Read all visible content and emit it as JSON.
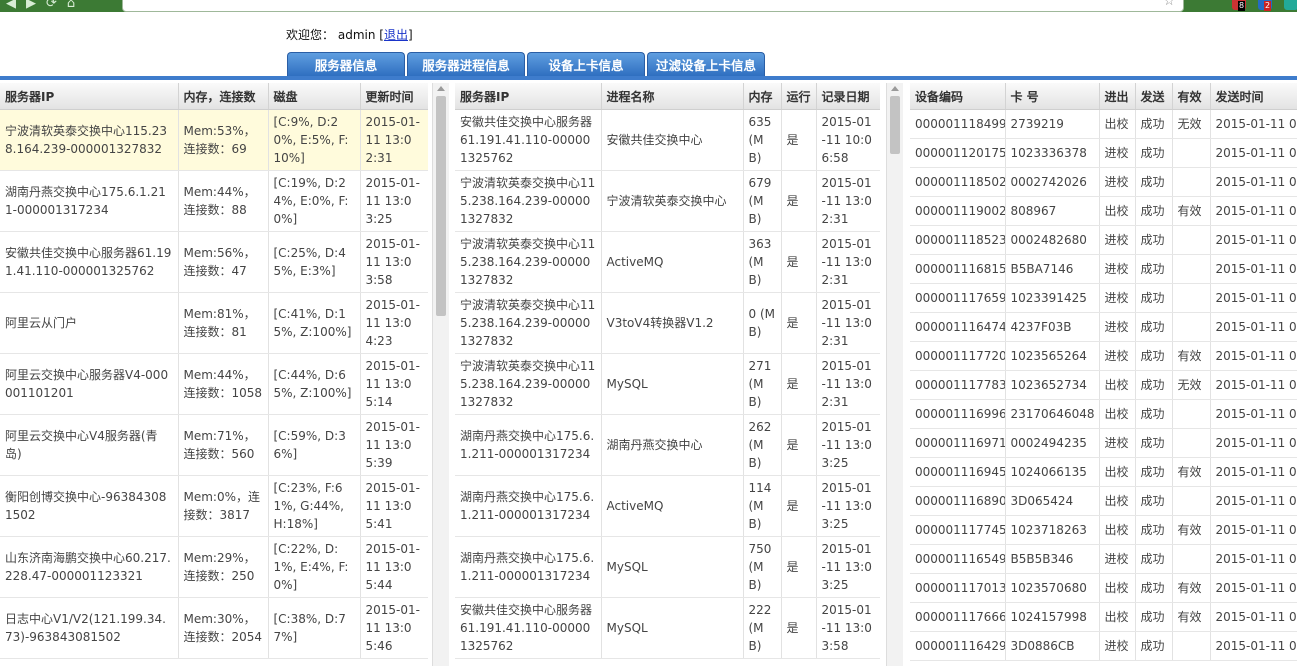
{
  "welcome": {
    "prefix": "欢迎您：",
    "user": "admin",
    "bracket_open": "[",
    "logout": "退出",
    "bracket_close": "]"
  },
  "tabs": [
    "服务器信息",
    "服务器进程信息",
    "设备上卡信息",
    "过滤设备上卡信息"
  ],
  "server_table": {
    "headers": [
      "服务器IP",
      "内存，连接数",
      "磁盘",
      "更新时间"
    ],
    "rows": [
      [
        "宁波清软英泰交换中心115.238.164.239-000001327832",
        "Mem:53%，连接数：69",
        "[C:9%, D:20%, E:5%, F:10%]",
        "2015-01-11 13:02:31"
      ],
      [
        "湖南丹燕交换中心175.6.1.211-000001317234",
        "Mem:44%，连接数：88",
        "[C:19%, D:24%, E:0%, F:0%]",
        "2015-01-11 13:03:25"
      ],
      [
        "安徽共佳交换中心服务器61.191.41.110-000001325762",
        "Mem:56%，连接数：47",
        "[C:25%, D:45%, E:3%]",
        "2015-01-11 13:03:58"
      ],
      [
        "阿里云从门户",
        "Mem:81%，连接数：81",
        "[C:41%, D:15%, Z:100%]",
        "2015-01-11 13:04:23"
      ],
      [
        "阿里云交换中心服务器V4-000001101201",
        "Mem:44%，连接数：1058",
        "[C:44%, D:65%, Z:100%]",
        "2015-01-11 13:05:14"
      ],
      [
        "阿里云交换中心V4服务器(青岛)",
        "Mem:71%，连接数：560",
        "[C:59%, D:36%]",
        "2015-01-11 13:05:39"
      ],
      [
        "衡阳创博交换中心-963843081502",
        "Mem:0%，连接数：3817",
        "[C:23%, F:61%, G:44%, H:18%]",
        "2015-01-11 13:05:41"
      ],
      [
        "山东济南海鹏交换中心60.217.228.47-000001123321",
        "Mem:29%，连接数：250",
        "[C:22%, D:1%, E:4%, F:0%]",
        "2015-01-11 13:05:44"
      ],
      [
        "日志中心V1/V2(121.199.34.73)-963843081502",
        "Mem:30%，连接数：2054",
        "[C:38%, D:77%]",
        "2015-01-11 13:05:46"
      ]
    ]
  },
  "process_table": {
    "headers": [
      "服务器IP",
      "进程名称",
      "内存",
      "运行",
      "记录日期"
    ],
    "rows": [
      [
        "安徽共佳交换中心服务器61.191.41.110-000001325762",
        "安徽共佳交换中心",
        "635 (MB)",
        "是",
        "2015-01-11 10:06:58"
      ],
      [
        "宁波清软英泰交换中心115.238.164.239-000001327832",
        "宁波清软英泰交换中心",
        "679 (MB)",
        "是",
        "2015-01-11 13:02:31"
      ],
      [
        "宁波清软英泰交换中心115.238.164.239-000001327832",
        "ActiveMQ",
        "363 (MB)",
        "是",
        "2015-01-11 13:02:31"
      ],
      [
        "宁波清软英泰交换中心115.238.164.239-000001327832",
        "V3toV4转换器V1.2",
        "0 (MB)",
        "是",
        "2015-01-11 13:02:31"
      ],
      [
        "宁波清软英泰交换中心115.238.164.239-000001327832",
        "MySQL",
        "271 (MB)",
        "是",
        "2015-01-11 13:02:31"
      ],
      [
        "湖南丹燕交换中心175.6.1.211-000001317234",
        "湖南丹燕交换中心",
        "262 (MB)",
        "是",
        "2015-01-11 13:03:25"
      ],
      [
        "湖南丹燕交换中心175.6.1.211-000001317234",
        "ActiveMQ",
        "114 (MB)",
        "是",
        "2015-01-11 13:03:25"
      ],
      [
        "湖南丹燕交换中心175.6.1.211-000001317234",
        "MySQL",
        "750 (MB)",
        "是",
        "2015-01-11 13:03:25"
      ],
      [
        "安徽共佳交换中心服务器61.191.41.110-000001325762",
        "MySQL",
        "222 (MB)",
        "是",
        "2015-01-11 13:03:58"
      ]
    ]
  },
  "device_table": {
    "headers": [
      "设备编码",
      "卡 号",
      "进出",
      "发送",
      "有效",
      "发送时间"
    ],
    "rows": [
      [
        "000001118499",
        "2739219",
        "出校",
        "成功",
        "无效",
        "2015-01-11 05:4"
      ],
      [
        "000001120175",
        "1023336378",
        "进校",
        "成功",
        "",
        "2015-01-11 05:5"
      ],
      [
        "000001118502",
        "0002742026",
        "进校",
        "成功",
        "",
        "2015-01-11 06:4"
      ],
      [
        "000001119002",
        "808967",
        "出校",
        "成功",
        "有效",
        "2015-01-11 07:0"
      ],
      [
        "000001118523",
        "0002482680",
        "进校",
        "成功",
        "",
        "2015-01-11 07:0"
      ],
      [
        "000001116815",
        "B5BA7146",
        "进校",
        "成功",
        "",
        "2015-01-11 07:2"
      ],
      [
        "000001117659",
        "1023391425",
        "进校",
        "成功",
        "",
        "2015-01-11 07:3"
      ],
      [
        "000001116474",
        "4237F03B",
        "进校",
        "成功",
        "",
        "2015-01-11 07:4"
      ],
      [
        "000001117720",
        "1023565264",
        "进校",
        "成功",
        "有效",
        "2015-01-11 07:4"
      ],
      [
        "000001117783",
        "1023652734",
        "出校",
        "成功",
        "无效",
        "2015-01-11 07:4"
      ],
      [
        "000001116996",
        "23170646048",
        "出校",
        "成功",
        "",
        "2015-01-11 08:0"
      ],
      [
        "000001116971",
        "0002494235",
        "进校",
        "成功",
        "",
        "2015-01-11 08:2"
      ],
      [
        "000001116945",
        "1024066135",
        "出校",
        "成功",
        "有效",
        "2015-01-11 08:2"
      ],
      [
        "000001116890",
        "3D065424",
        "出校",
        "成功",
        "",
        "2015-01-11 08:3"
      ],
      [
        "000001117745",
        "1023718263",
        "出校",
        "成功",
        "有效",
        "2015-01-11 08:3"
      ],
      [
        "000001116549",
        "B5B5B346",
        "进校",
        "成功",
        "",
        "2015-01-11 08:3"
      ],
      [
        "000001117013",
        "1023570680",
        "出校",
        "成功",
        "有效",
        "2015-01-11 08:3"
      ],
      [
        "000001117666",
        "1024157998",
        "出校",
        "成功",
        "有效",
        "2015-01-11 08:4"
      ],
      [
        "000001116429",
        "3D0886CB",
        "进校",
        "成功",
        "",
        "2015-01-11 08:4"
      ]
    ]
  },
  "colors": {
    "tab": "#3a7fd0",
    "link": "#1a22c8",
    "invalid": "#e02020",
    "selected_row": "#fffbdc"
  }
}
